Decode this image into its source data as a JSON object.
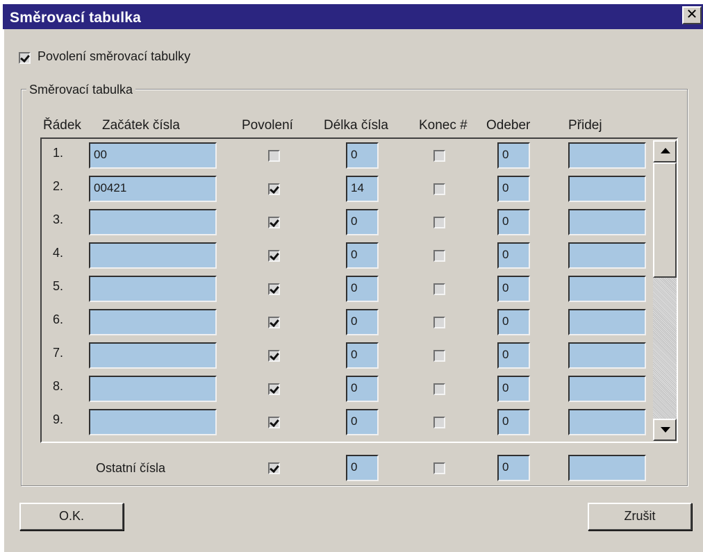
{
  "window": {
    "title": "Směrovací tabulka",
    "close_glyph": "✕",
    "close_icon": "close-icon"
  },
  "enable_table": {
    "label": "Povolení směrovací tabulky",
    "checked": true
  },
  "group": {
    "legend": "Směrovací tabulka"
  },
  "columns": {
    "row": "Řádek",
    "prefix": "Začátek čísla",
    "enabled": "Povolení",
    "length": "Délka čísla",
    "hash_end": "Konec #",
    "remove": "Odeber",
    "add": "Přidej"
  },
  "rows": [
    {
      "num": "1.",
      "prefix": "00",
      "enabled": false,
      "length": "0",
      "hash_end": false,
      "remove": "0",
      "add": ""
    },
    {
      "num": "2.",
      "prefix": "00421",
      "enabled": true,
      "length": "14",
      "hash_end": false,
      "remove": "0",
      "add": ""
    },
    {
      "num": "3.",
      "prefix": "",
      "enabled": true,
      "length": "0",
      "hash_end": false,
      "remove": "0",
      "add": ""
    },
    {
      "num": "4.",
      "prefix": "",
      "enabled": true,
      "length": "0",
      "hash_end": false,
      "remove": "0",
      "add": ""
    },
    {
      "num": "5.",
      "prefix": "",
      "enabled": true,
      "length": "0",
      "hash_end": false,
      "remove": "0",
      "add": ""
    },
    {
      "num": "6.",
      "prefix": "",
      "enabled": true,
      "length": "0",
      "hash_end": false,
      "remove": "0",
      "add": ""
    },
    {
      "num": "7.",
      "prefix": "",
      "enabled": true,
      "length": "0",
      "hash_end": false,
      "remove": "0",
      "add": ""
    },
    {
      "num": "8.",
      "prefix": "",
      "enabled": true,
      "length": "0",
      "hash_end": false,
      "remove": "0",
      "add": ""
    },
    {
      "num": "9.",
      "prefix": "",
      "enabled": true,
      "length": "0",
      "hash_end": false,
      "remove": "0",
      "add": ""
    }
  ],
  "other": {
    "label": "Ostatní čísla",
    "enabled": true,
    "length": "0",
    "hash_end": false,
    "remove": "0",
    "add": ""
  },
  "buttons": {
    "ok": "O.K.",
    "cancel": "Zrušit"
  },
  "colors": {
    "titlebar": "#2b2580",
    "field_bg": "#a8c7e2",
    "dialog_bg": "#d4d0c8"
  }
}
